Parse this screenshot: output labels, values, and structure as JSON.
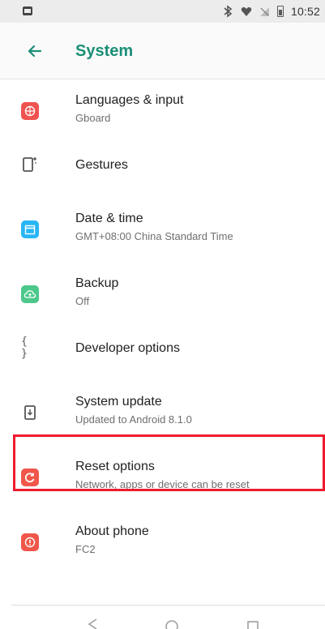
{
  "status_bar": {
    "time": "10:52",
    "icons": [
      "notification-icon",
      "bluetooth-icon",
      "wifi-icon",
      "no-signal-icon",
      "battery-icon"
    ]
  },
  "app_bar": {
    "title": "System",
    "back_icon": "arrow-back-icon",
    "title_color": "#1b8f77"
  },
  "settings": [
    {
      "title": "Languages & input",
      "subtitle": "Gboard",
      "icon": "globe-icon",
      "color": "#ef5350"
    },
    {
      "title": "Gestures",
      "subtitle": "",
      "icon": "gesture-phone-icon",
      "color": "#555555"
    },
    {
      "title": "Date & time",
      "subtitle": "GMT+08:00 China Standard Time",
      "icon": "calendar-icon",
      "color": "#29b6f6"
    },
    {
      "title": "Backup",
      "subtitle": "Off",
      "icon": "cloud-backup-icon",
      "color": "#4cc88b"
    },
    {
      "title": "Developer options",
      "subtitle": "",
      "icon": "braces-icon",
      "color": "#555555"
    },
    {
      "title": "System update",
      "subtitle": "Updated to Android 8.1.0",
      "icon": "system-update-icon",
      "color": "#555555"
    },
    {
      "title": "Reset options",
      "subtitle": "Network, apps or device can be reset",
      "icon": "reset-icon",
      "color": "#f0574a",
      "highlighted": true
    },
    {
      "title": "About phone",
      "subtitle": "FC2",
      "icon": "info-icon",
      "color": "#f0574a"
    }
  ],
  "nav_bar": {
    "buttons": [
      "back-nav-icon",
      "home-nav-icon",
      "recents-nav-icon"
    ]
  },
  "colors": {
    "highlight_border": "#ef1b2d"
  }
}
